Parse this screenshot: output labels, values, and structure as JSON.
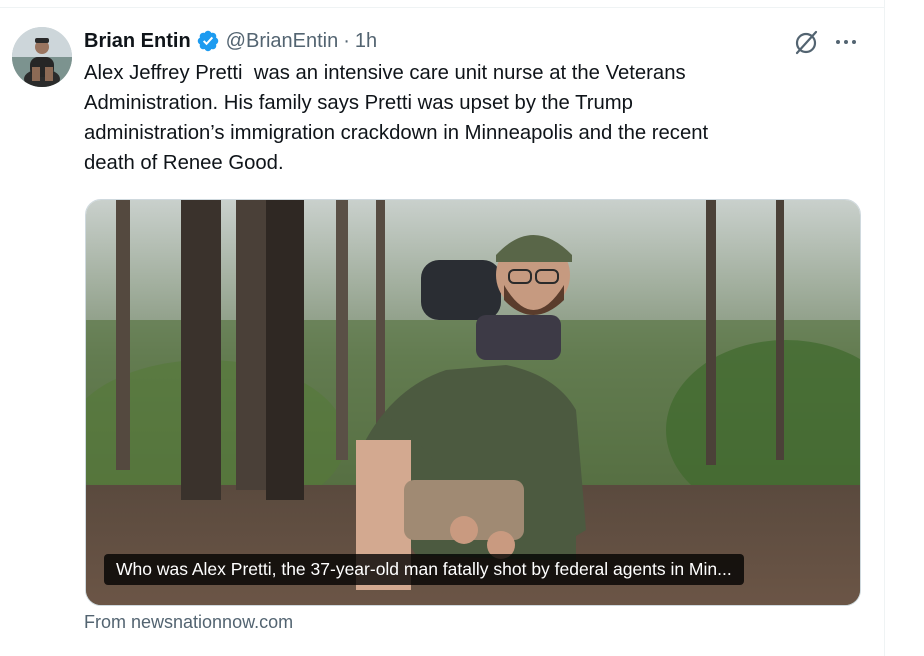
{
  "author": {
    "name": "Brian Entin",
    "handle": "@BrianEntin",
    "separator": "·",
    "time": "1h",
    "verified_badge_color": "#1d9bf0"
  },
  "tweet": {
    "lines": [
      "Alex Jeffrey Pretti  was an intensive care unit nurse at the Veterans",
      "Administration. His family says Pretti was upset by the Trump",
      "administration’s immigration crackdown in Minneapolis and the recent",
      "death of Renee Good."
    ]
  },
  "card": {
    "caption": "Who was Alex Pretti, the 37-year-old man fatally shot by federal agents in Min...",
    "source": "From newsnationnow.com"
  },
  "icons": {
    "verified": "verified-badge-icon",
    "grok": "grok-icon",
    "more": "more-options-icon"
  },
  "colors": {
    "text_primary": "#0f1419",
    "text_secondary": "#536471",
    "border": "#cfd9de"
  }
}
